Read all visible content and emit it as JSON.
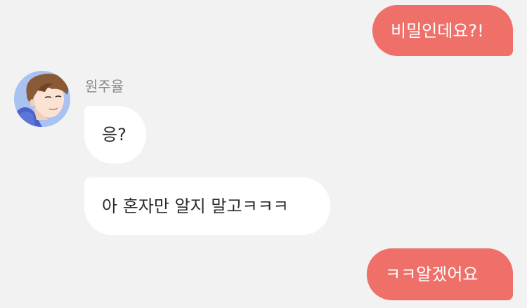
{
  "chat": {
    "messages": [
      {
        "sender": "me",
        "text": "비밀인데요?!"
      },
      {
        "sender": "원주율",
        "text": "응?"
      },
      {
        "sender": "원주율",
        "text": "아 혼자만 알지 말고ㅋㅋㅋ"
      },
      {
        "sender": "me",
        "text": "ㅋㅋ알겠어요"
      }
    ],
    "contact": {
      "name": "원주율",
      "avatar_icon": "profile-avatar-icon"
    }
  },
  "colors": {
    "background": "#f2f2f2",
    "outgoing_bubble": "#ee7069",
    "incoming_bubble": "#ffffff",
    "name_text": "#888888"
  }
}
